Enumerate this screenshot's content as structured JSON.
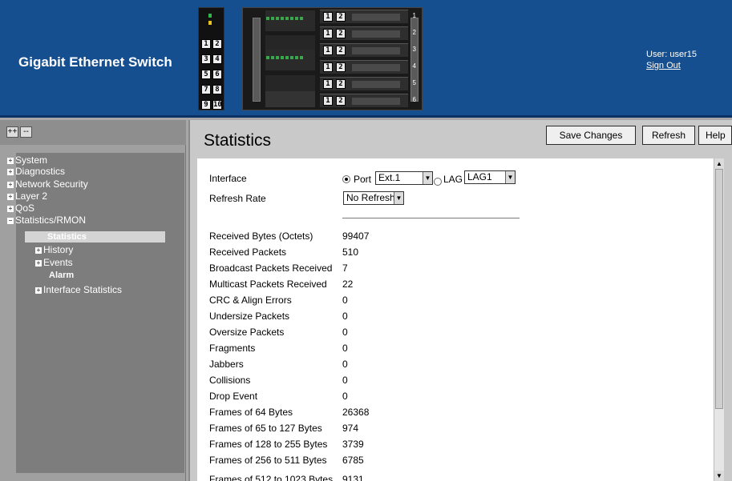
{
  "header": {
    "app_title": "Gigabit Ethernet Switch",
    "user_label": "User: user15",
    "sign_out": "Sign Out",
    "device_ps_labels": [
      "1",
      "2",
      "3",
      "4",
      "5",
      "6",
      "7",
      "8",
      "9",
      "10"
    ],
    "bay_numbers": [
      "1",
      "2",
      "3",
      "4",
      "5",
      "6"
    ],
    "bay_module_labels": [
      "1",
      "2"
    ]
  },
  "nav": {
    "expand_all": "++",
    "collapse_all": "--",
    "items": [
      {
        "label": "System",
        "expander": "+"
      },
      {
        "label": "Diagnostics",
        "expander": "+"
      },
      {
        "label": "Network Security",
        "expander": "+"
      },
      {
        "label": "Layer 2",
        "expander": "+"
      },
      {
        "label": "QoS",
        "expander": "+"
      },
      {
        "label": "Statistics/RMON",
        "expander": "−"
      },
      {
        "label": "Statistics"
      },
      {
        "label": "History",
        "expander": "+"
      },
      {
        "label": "Events",
        "expander": "+"
      },
      {
        "label": "Alarm"
      },
      {
        "label": "Interface Statistics",
        "expander": "+"
      }
    ]
  },
  "main": {
    "title": "Statistics",
    "buttons": {
      "save": "Save Changes",
      "refresh": "Refresh",
      "help": "Help"
    },
    "form": {
      "interface_label": "Interface",
      "port_label": "Port",
      "port_value": "Ext.1",
      "lag_label": "LAG",
      "lag_value": "LAG1",
      "refresh_rate_label": "Refresh Rate",
      "refresh_rate_value": "No Refresh"
    },
    "stats": [
      {
        "label": "Received Bytes (Octets)",
        "value": "99407"
      },
      {
        "label": "Received Packets",
        "value": "510"
      },
      {
        "label": "Broadcast Packets Received",
        "value": "7"
      },
      {
        "label": "Multicast Packets Received",
        "value": "22"
      },
      {
        "label": "CRC & Align Errors",
        "value": "0"
      },
      {
        "label": "Undersize Packets",
        "value": "0"
      },
      {
        "label": "Oversize Packets",
        "value": "0"
      },
      {
        "label": "Fragments",
        "value": "0"
      },
      {
        "label": "Jabbers",
        "value": "0"
      },
      {
        "label": "Collisions",
        "value": "0"
      },
      {
        "label": "Drop Event",
        "value": "0"
      },
      {
        "label": "Frames of 64 Bytes",
        "value": "26368"
      },
      {
        "label": "Frames of 65 to 127 Bytes",
        "value": "974"
      },
      {
        "label": "Frames of 128 to 255 Bytes",
        "value": "3739"
      },
      {
        "label": "Frames of 256 to 511 Bytes",
        "value": "6785"
      },
      {
        "label": "Frames of 512 to 1023 Bytes",
        "value": "9131"
      }
    ]
  },
  "colors": {
    "header": "#164f8f",
    "nav_bg": "#7d7d7d",
    "content_bg": "#ffffff"
  }
}
